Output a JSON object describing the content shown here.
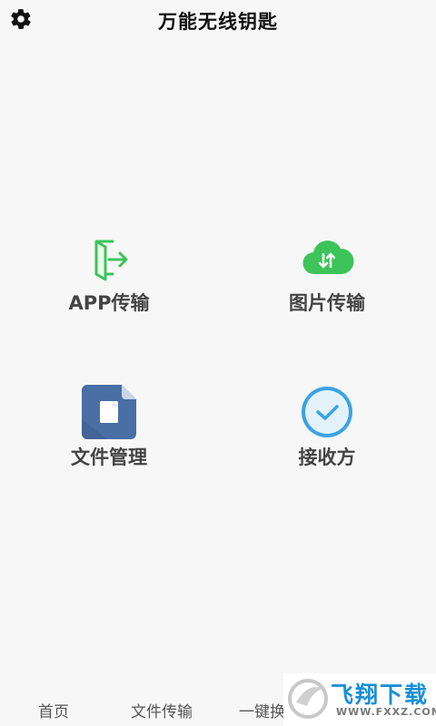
{
  "header": {
    "title": "万能无线钥匙",
    "settings_icon": "gear-icon"
  },
  "tiles": [
    {
      "label": "APP传输",
      "icon": "app-transfer-icon",
      "color": "#3cc45a"
    },
    {
      "label": "图片传输",
      "icon": "cloud-transfer-icon",
      "color": "#3cc45a"
    },
    {
      "label": "文件管理",
      "icon": "document-icon",
      "color": "#4a6fa5"
    },
    {
      "label": "接收方",
      "icon": "check-circle-icon",
      "color": "#3aa3e3"
    }
  ],
  "bottom_nav": [
    {
      "label": "首页"
    },
    {
      "label": "文件传输"
    },
    {
      "label": "一键换"
    }
  ],
  "watermark": {
    "text": "飞翔下载",
    "url": "WWW.FXXZ.COM"
  }
}
